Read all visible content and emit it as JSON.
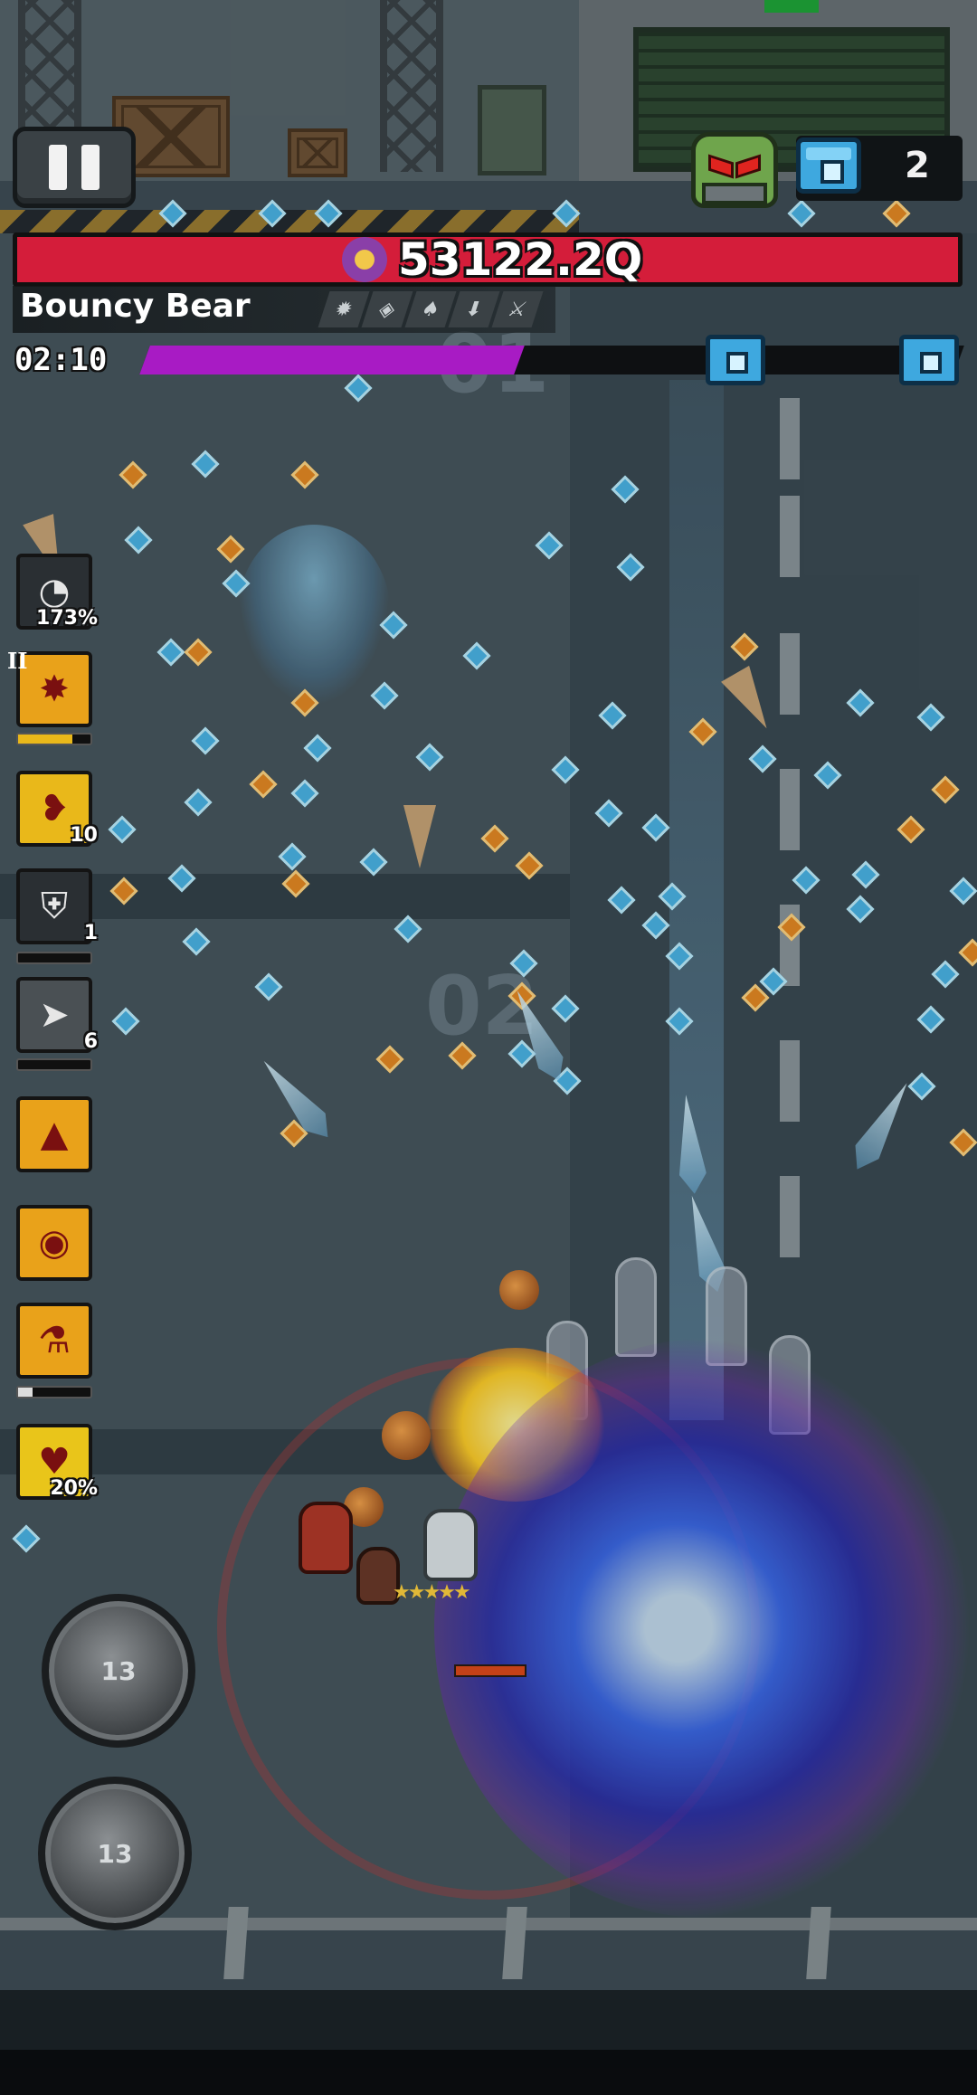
{
  "hud": {
    "boss_hp": "53122.2Q",
    "boss_name": "Bouncy Bear",
    "timer": "02:10",
    "chest_count": "2",
    "wave_progress": 0.46
  },
  "boss_traits": [
    {
      "icon": "gear-icon",
      "glyph": "✹"
    },
    {
      "icon": "shield-icon",
      "glyph": "◈"
    },
    {
      "icon": "flame-icon",
      "glyph": "♠"
    },
    {
      "icon": "arrow-down-icon",
      "glyph": "⬇"
    },
    {
      "icon": "slash-icon",
      "glyph": "⚔"
    }
  ],
  "skills": [
    {
      "icon": "speedometer-icon",
      "badge": "173%",
      "bg": "#2a2f33"
    },
    {
      "icon": "burst-icon",
      "badge": "",
      "bg": "#e9a21a",
      "tier": "II"
    },
    {
      "icon": "blood-drop-icon",
      "badge": "10",
      "bg": "#e9b81a"
    },
    {
      "icon": "shield-icon",
      "badge": "1",
      "bg": "#2a2f33"
    },
    {
      "icon": "drill-icon",
      "badge": "6",
      "bg": "#4a5054"
    },
    {
      "icon": "penguin-upgrade-icon",
      "badge": "",
      "bg": "#e9a21a"
    },
    {
      "icon": "cat-face-icon",
      "badge": "",
      "bg": "#e9a21a"
    },
    {
      "icon": "potion-icon",
      "badge": "",
      "bg": "#e9a21a"
    },
    {
      "icon": "heart-icon",
      "badge": "20%",
      "bg": "#e9c51a"
    }
  ],
  "skill_bars": [
    0.75,
    0.0,
    0.0,
    0.2,
    0.0
  ],
  "action_buttons": [
    {
      "name": "ultimate-skill-button",
      "cooldown": "13"
    },
    {
      "name": "dash-skill-button",
      "cooldown": "13"
    }
  ],
  "player": {
    "stars": "★★★★★"
  },
  "colors": {
    "boss_bar": "#d41d3a",
    "progress": "#a81bc4",
    "chest": "#3ea8df"
  }
}
